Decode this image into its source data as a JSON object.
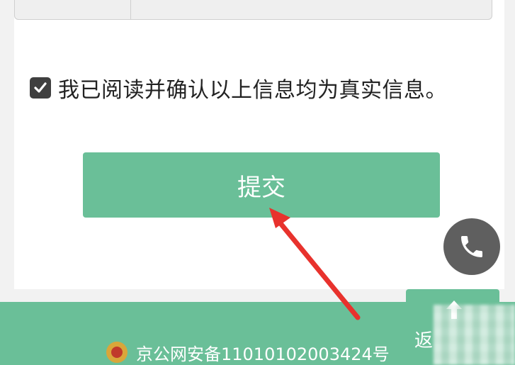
{
  "form": {
    "input_value": "",
    "agree_checked": true,
    "agree_label": "我已阅读并确认以上信息均为真实信息。",
    "submit_label": "提交"
  },
  "float": {
    "phone_icon": "phone-icon",
    "back_top_label": "返"
  },
  "footer": {
    "icp_text": "京公网安备11010102003424号"
  },
  "colors": {
    "accent": "#6abf98",
    "phone_bg": "#5f5f5f",
    "arrow": "#e8322d"
  }
}
